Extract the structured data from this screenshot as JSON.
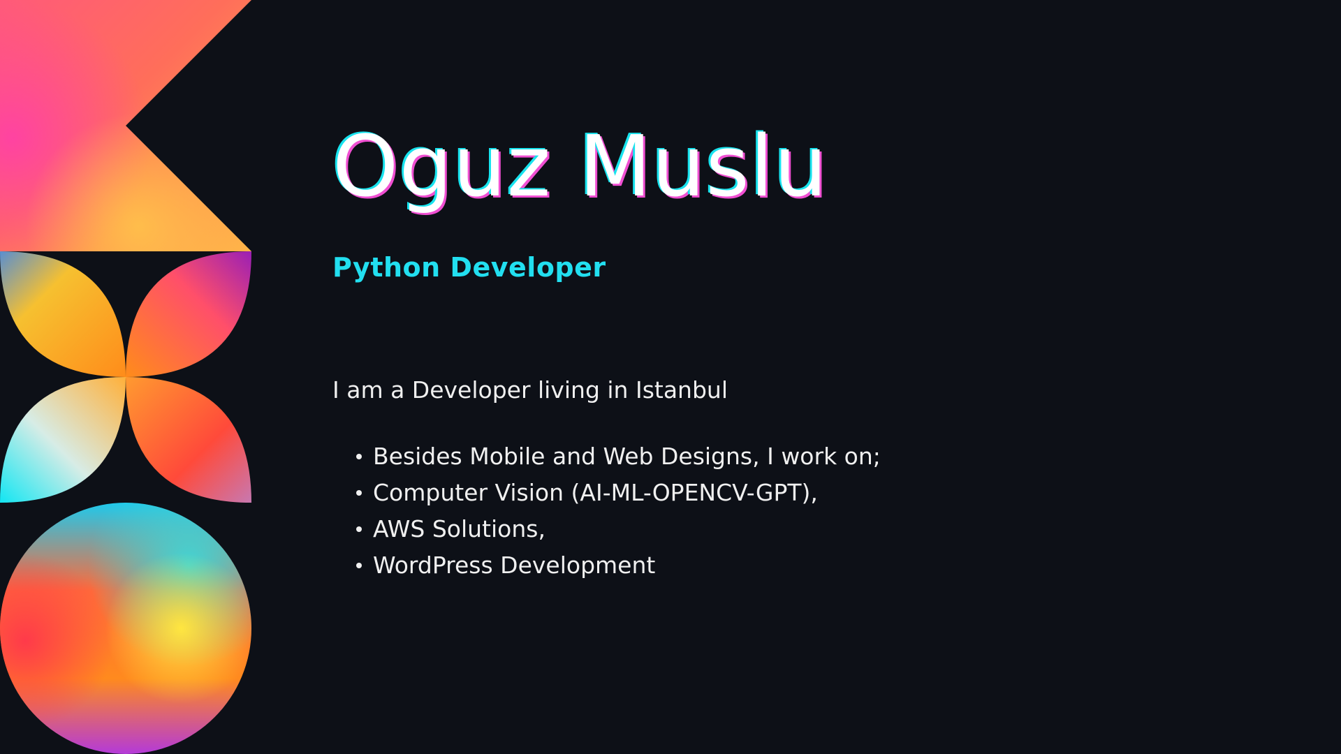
{
  "profile": {
    "name": "Oguz Muslu",
    "role": "Python Developer",
    "intro": "I am a Developer living in Istanbul",
    "bullets": [
      "Besides Mobile and Web Designs, I work on;",
      "Computer Vision (AI-ML-OPENCV-GPT),",
      "AWS Solutions,",
      "WordPress Development"
    ]
  },
  "colors": {
    "background": "#0d1017",
    "name_outline_cyan": "#18e3ee",
    "name_outline_magenta": "#f04fd2",
    "role_text": "#22dff0",
    "body_text": "#f0f0f0"
  },
  "decoration": {
    "shapes": [
      "notched-flag-shape",
      "four-petal-flower-shape",
      "gradient-sphere-shape"
    ]
  }
}
